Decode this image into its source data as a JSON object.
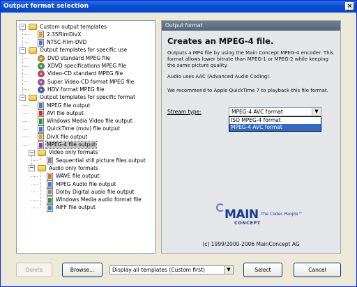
{
  "window": {
    "title": "Output format selection",
    "close_glyph": "×"
  },
  "tree": {
    "nodes": [
      {
        "label": "Custom output templates",
        "icon": "folder-icon"
      },
      {
        "label": "2.35FilmDivX",
        "icon": "doc-icon",
        "color": "#e0a020"
      },
      {
        "label": "NTSC-Film-DVD",
        "icon": "doc-icon",
        "color": "#3a7bd5"
      },
      {
        "label": "Output templates for specific use",
        "icon": "folder-icon"
      },
      {
        "label": "DVD standard MPEG file",
        "icon": "disc-icon",
        "color": "#d4a017"
      },
      {
        "label": "XDVD specifications MPEG file",
        "icon": "disc-icon",
        "color": "#3aa04a"
      },
      {
        "label": "Video-CD standard MPEG file",
        "icon": "disc-icon",
        "color": "#c44"
      },
      {
        "label": "Super Video-CD format MPEG file",
        "icon": "disc-icon",
        "color": "#b04ab0"
      },
      {
        "label": "HDV format MPEG file",
        "icon": "disc-icon",
        "color": "#3a60c0"
      },
      {
        "label": "Output templates for specific format",
        "icon": "folder-icon"
      },
      {
        "label": "MPEG file output",
        "icon": "doc-icon",
        "color": "#3a7bd5"
      },
      {
        "label": "AVI file output",
        "icon": "doc-icon",
        "color": "#c03030"
      },
      {
        "label": "Windows Media Video file output",
        "icon": "doc-icon",
        "color": "#2a9a2a"
      },
      {
        "label": "QuickTime (mov) file output",
        "icon": "doc-icon",
        "color": "#3a7bd5"
      },
      {
        "label": "DivX file output",
        "icon": "doc-icon",
        "color": "#e0a020"
      },
      {
        "label": "MPEG-4 file output",
        "icon": "doc-icon",
        "color": "#8a3ab0"
      },
      {
        "label": "Video only formats",
        "icon": "folder-icon"
      },
      {
        "label": "Sequential still picture files output",
        "icon": "doc-icon",
        "color": "#888"
      },
      {
        "label": "Audio only formats",
        "icon": "folder-icon"
      },
      {
        "label": "WAVE file output",
        "icon": "doc-icon",
        "color": "#e07020"
      },
      {
        "label": "MPEG Audio file output",
        "icon": "doc-icon",
        "color": "#3a7bd5"
      },
      {
        "label": "Dolby Digital audio file output",
        "icon": "doc-icon",
        "color": "#888"
      },
      {
        "label": "Windows Media audio format file",
        "icon": "doc-icon",
        "color": "#2a9a2a"
      },
      {
        "label": "AIFF file output",
        "icon": "doc-icon",
        "color": "#3a7bd5"
      }
    ],
    "selected_index": 15
  },
  "details": {
    "header": "Output format",
    "title": "Creates an MPEG-4 file.",
    "description": "Outputs a MP4 file by using the Main Concept MPEG-4 encoder. This format allows lower bitrate than MPEG-1 or MPEG-2 while keeping the same picture quality.",
    "audio_note": "Audio uses AAC (Advanced Audio Coding).",
    "recommendation": "We recommend to Apple QuickTime 7 to playback this file format.",
    "stream_type_label": "Stream type:",
    "stream_type_value": "MPEG-4 AVC format",
    "stream_type_options": [
      "ISO MPEG-4 format",
      "MPEG-4 AVC format"
    ],
    "stream_type_selected": 1,
    "logo_main": "MAIN",
    "logo_concept": "CONCEPT",
    "logo_tagline": "The Codec People™",
    "copyright": "(c) 1999/2000-2006 MainConcept AG"
  },
  "bottom": {
    "delete_label": "Delete",
    "browse_label": "Browse...",
    "filter_value": "Display all templates (Custom first)",
    "select_label": "Select",
    "cancel_label": "Cancel"
  }
}
